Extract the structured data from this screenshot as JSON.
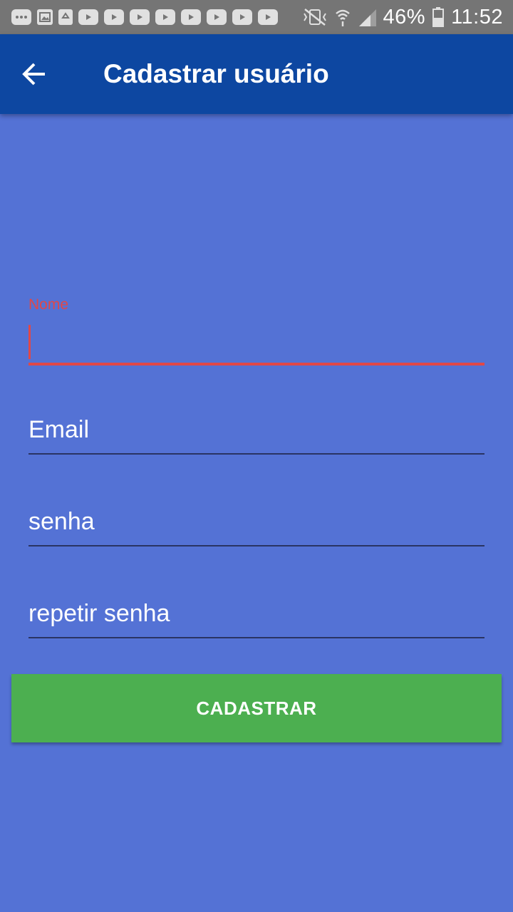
{
  "status_bar": {
    "battery_percent": "46%",
    "time": "11:52",
    "notification_icons": [
      "chat-bubble-icon",
      "image-icon",
      "recycle-icon",
      "youtube-icon",
      "youtube-icon",
      "youtube-icon",
      "youtube-icon",
      "youtube-icon",
      "youtube-icon",
      "youtube-icon",
      "youtube-icon"
    ],
    "system_icons": [
      "vibrate-mute-icon",
      "wifi-icon",
      "signal-icon",
      "battery-icon"
    ]
  },
  "app_bar": {
    "title": "Cadastrar usuário",
    "back_icon": "arrow-left-icon",
    "background": "#0d47a1"
  },
  "form": {
    "name_field": {
      "label": "Nome",
      "value": ""
    },
    "email_field": {
      "placeholder": "Email",
      "value": ""
    },
    "password_field": {
      "placeholder": "senha",
      "value": ""
    },
    "repeat_password_field": {
      "placeholder": "repetir senha",
      "value": ""
    }
  },
  "submit_button": {
    "label": "CADASTRAR",
    "color": "#4caf50"
  },
  "colors": {
    "background": "#5472d5",
    "error_accent": "#e04848",
    "status_bar": "#757575"
  }
}
